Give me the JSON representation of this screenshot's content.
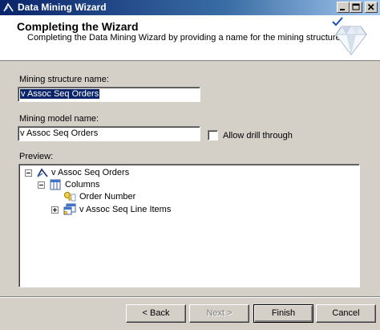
{
  "window": {
    "title": "Data Mining Wizard"
  },
  "header": {
    "title": "Completing the Wizard",
    "subtitle": "Completing the Data Mining Wizard by providing a name for the mining structure."
  },
  "form": {
    "structure_label": "Mining structure name:",
    "structure_value": "v Assoc Seq Orders",
    "model_label": "Mining model name:",
    "model_value": "v Assoc Seq Orders",
    "drill_label": "Allow drill through",
    "drill_checked": false,
    "preview_label": "Preview:"
  },
  "tree": {
    "root": "v Assoc Seq Orders",
    "columns": "Columns",
    "key": "Order Number",
    "nested": "v Assoc Seq Line Items"
  },
  "buttons": {
    "back": "< Back",
    "next": "Next >",
    "finish": "Finish",
    "cancel": "Cancel"
  },
  "colors": {
    "titlebar_start": "#0a246a",
    "titlebar_end": "#a6caf0",
    "dialog_bg": "#d4d0c8",
    "selection": "#0a246a"
  },
  "icons": [
    "mining-wizard-icon",
    "minimize-icon",
    "maximize-icon",
    "close-icon",
    "checkmark-icon",
    "diamond-icon",
    "mining-structure-icon",
    "columns-icon",
    "key-icon",
    "nested-table-icon"
  ]
}
